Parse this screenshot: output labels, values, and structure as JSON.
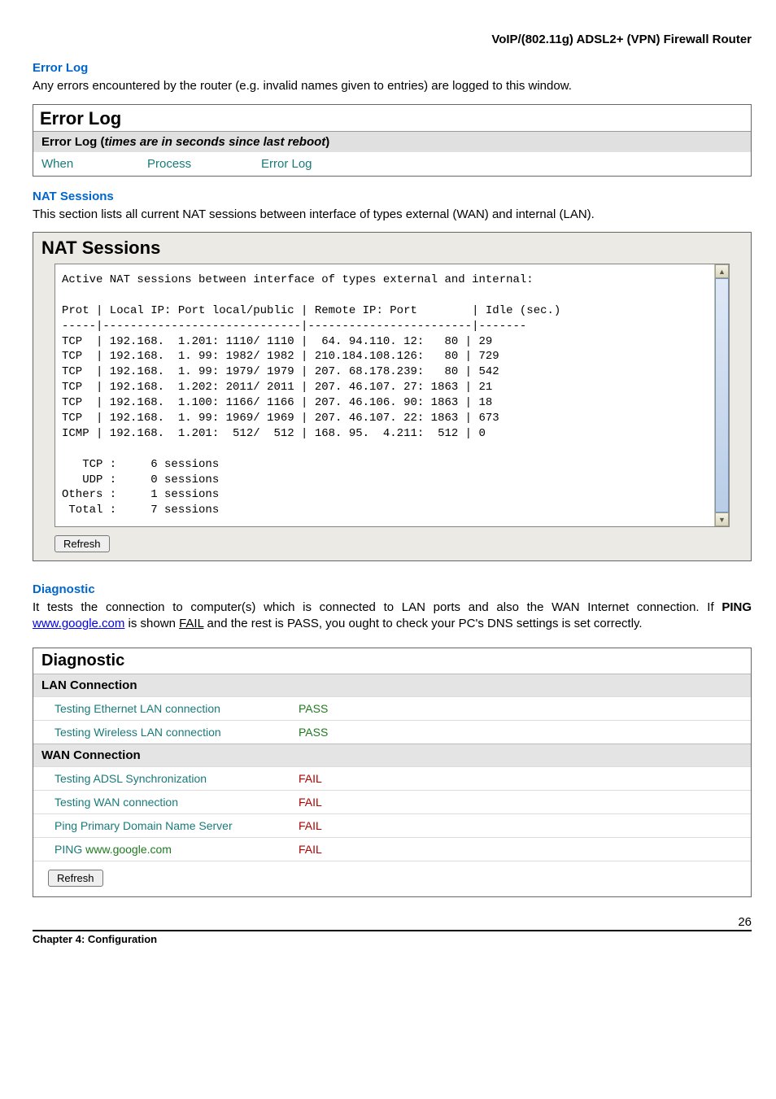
{
  "header": {
    "right_title": "VoIP/(802.11g) ADSL2+ (VPN) Firewall Router"
  },
  "errorlog": {
    "section_title": "Error Log",
    "intro": "Any errors encountered by the router (e.g. invalid names given to entries) are logged to this window.",
    "panel_title": "Error Log",
    "subtitle_prefix": "Error Log (",
    "subtitle_italic": "times are in seconds since last reboot",
    "subtitle_suffix": ")",
    "col_when": "When",
    "col_process": "Process",
    "col_log": "Error Log"
  },
  "nat": {
    "section_title": "NAT Sessions",
    "intro": "This section lists all current NAT sessions between interface of types external (WAN) and internal (LAN).",
    "panel_title": "NAT Sessions",
    "pre_text": "Active NAT sessions between interface of types external and internal:\n\nProt | Local IP: Port local/public | Remote IP: Port        | Idle (sec.)\n-----|-----------------------------|------------------------|-------\nTCP  | 192.168.  1.201: 1110/ 1110 |  64. 94.110. 12:   80 | 29\nTCP  | 192.168.  1. 99: 1982/ 1982 | 210.184.108.126:   80 | 729\nTCP  | 192.168.  1. 99: 1979/ 1979 | 207. 68.178.239:   80 | 542\nTCP  | 192.168.  1.202: 2011/ 2011 | 207. 46.107. 27: 1863 | 21\nTCP  | 192.168.  1.100: 1166/ 1166 | 207. 46.106. 90: 1863 | 18\nTCP  | 192.168.  1. 99: 1969/ 1969 | 207. 46.107. 22: 1863 | 673\nICMP | 192.168.  1.201:  512/  512 | 168. 95.  4.211:  512 | 0\n\n   TCP :     6 sessions\n   UDP :     0 sessions\nOthers :     1 sessions\n Total :     7 sessions\n",
    "refresh": "Refresh"
  },
  "diag": {
    "section_title": "Diagnostic",
    "intro_1": "It tests the connection to computer(s) which is connected to LAN ports and also the WAN Internet connection.   If ",
    "intro_bold": "PING ",
    "intro_link": "www.google.com",
    "intro_2": " is shown ",
    "intro_fail": "FAIL",
    "intro_3": " and the rest is PASS, you ought to check your PC's DNS settings is set correctly.",
    "panel_title": "Diagnostic",
    "lan_header": "LAN Connection",
    "wan_header": "WAN Connection",
    "rows": {
      "lan1_label": "Testing Ethernet LAN connection",
      "lan1_val": "PASS",
      "lan2_label": "Testing Wireless LAN connection",
      "lan2_val": "PASS",
      "wan1_label": "Testing ADSL Synchronization",
      "wan1_val": "FAIL",
      "wan2_label": "Testing WAN connection",
      "wan2_val": "FAIL",
      "wan3_label": "Ping Primary Domain Name Server",
      "wan3_val": "FAIL",
      "wan4_prefix": "PING ",
      "wan4_link": "www.google.com",
      "wan4_val": "FAIL"
    },
    "refresh": "Refresh"
  },
  "footer": {
    "chapter": "Chapter 4: Configuration",
    "page": "26"
  }
}
